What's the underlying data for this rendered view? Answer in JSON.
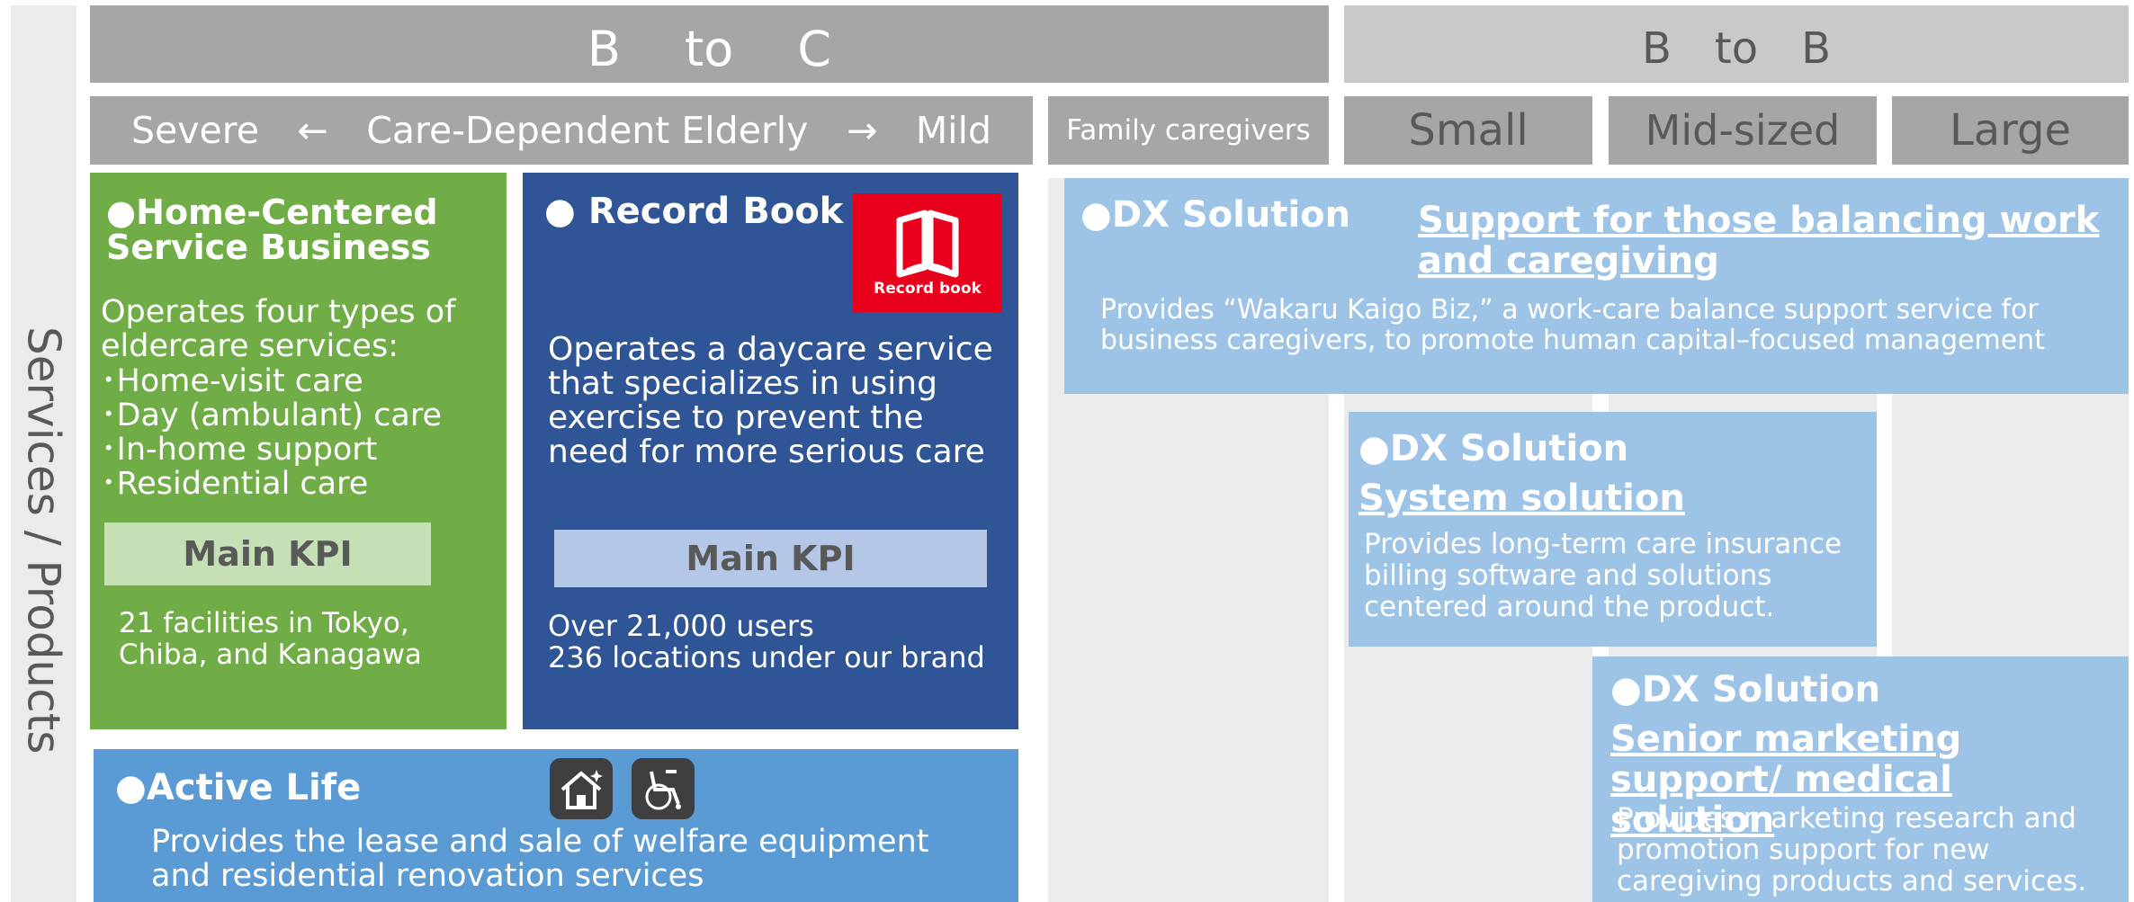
{
  "header": {
    "btoc": "B　 to 　C",
    "btob": "B　to　B"
  },
  "subheader": {
    "severe": "Severe",
    "arrow_left": "←",
    "care_dependent": "Care-Dependent Elderly",
    "arrow_right": "→",
    "mild": "Mild",
    "family": "Family caregivers",
    "small": "Small",
    "mid": "Mid-sized",
    "large": "Large"
  },
  "side_label": "Services / Products",
  "home_centered": {
    "title": "●Home-Centered Service Business",
    "intro": "Operates four types of eldercare services:",
    "items": [
      "･Home-visit care",
      "･Day (ambulant) care",
      "･In-home support",
      "･Residential care"
    ],
    "kpi_label": "Main KPI",
    "kpi_value": "21 facilities in Tokyo, Chiba, and Kanagawa"
  },
  "record_book": {
    "title": "● Record Book",
    "logo_text": "Record book",
    "body": "Operates a daycare service that specializes in using exercise to prevent the need for more serious care",
    "kpi_label": "Main KPI",
    "kpi_line1": "Over 21,000 users",
    "kpi_line2": "236 locations under our brand"
  },
  "active_life": {
    "title": "●Active Life",
    "body": "Provides the lease and sale of welfare equipment and residential renovation services",
    "icons": [
      "house-icon",
      "wheelchair-icon"
    ]
  },
  "dx_worklife": {
    "title": "●DX Solution",
    "link": "Support for those balancing work and caregiving",
    "body": "Provides “Wakaru Kaigo Biz,” a work-care balance support service for business caregivers, to promote human capital–focused management"
  },
  "dx_system": {
    "title": "●DX Solution",
    "link": "System solution",
    "body": "Provides long-term care insurance billing software and solutions centered around the product."
  },
  "dx_senior": {
    "title": "●DX Solution",
    "link": "Senior marketing support/ medical solution",
    "body": "Provides marketing research and promotion support for new caregiving products and services."
  },
  "colors": {
    "header_dark": "#a6a6a6",
    "header_light": "#c9c9c9",
    "green": "#70ad47",
    "navy": "#2f5597",
    "blue": "#5b9bd5",
    "light_blue": "#9dc3e6",
    "logo_red": "#e8001c"
  }
}
